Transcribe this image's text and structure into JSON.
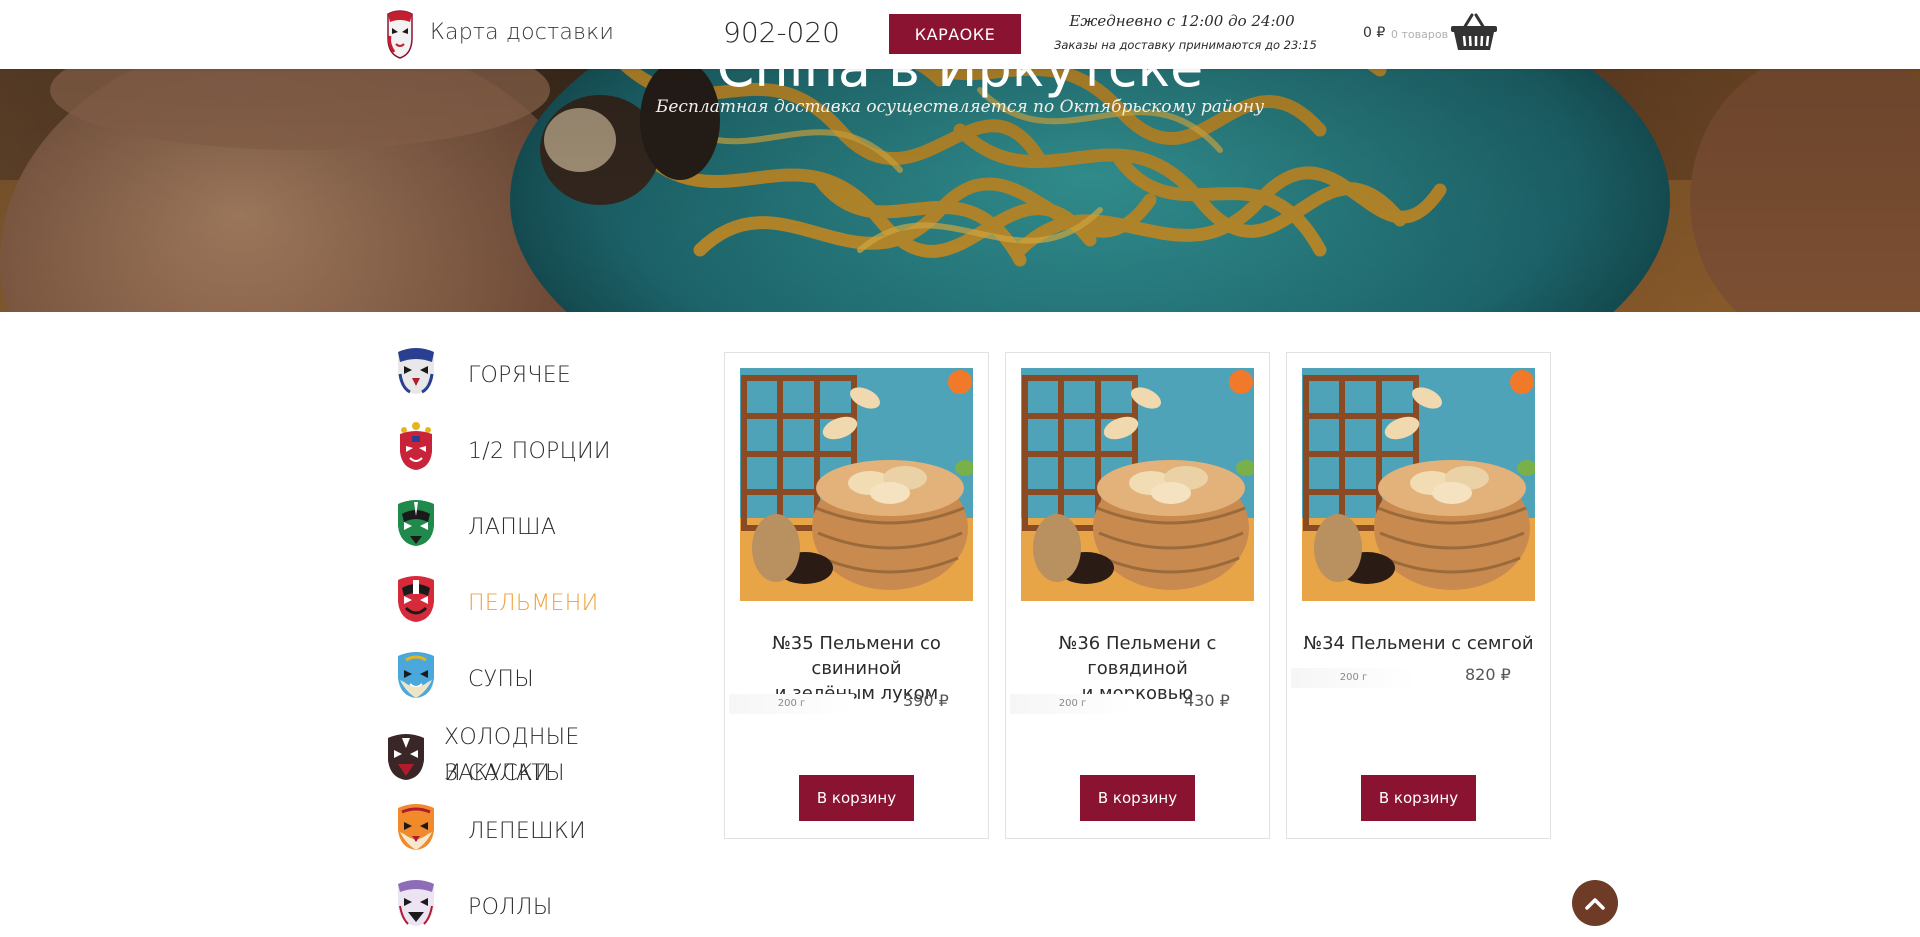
{
  "header": {
    "brand": "Карта доставки",
    "phone": "902-020",
    "karaoke_label": "КАРАОКЕ",
    "hours_line1": "Ежедневно с  12:00 до 24:00",
    "hours_line2": "Заказы на доставку принимаются до 23:15",
    "cart_total": "0 ₽",
    "cart_count": "0 товаров",
    "basket_icon": "basket-icon",
    "logo_icon": "opera-mask-logo"
  },
  "hero": {
    "title": "China в Иркутске",
    "subtitle": "Бесплатная доставка осуществляется по Октябрьскому району"
  },
  "categories": [
    {
      "label": "ГОРЯЧЕЕ",
      "icon": "opera-mask-icon",
      "active": false
    },
    {
      "label": "1/2 ПОРЦИИ",
      "icon": "opera-mask-icon",
      "active": false
    },
    {
      "label": "ЛАПША",
      "icon": "opera-mask-icon",
      "active": false
    },
    {
      "label": "ПЕЛЬМЕНИ",
      "icon": "opera-mask-icon",
      "active": true
    },
    {
      "label": "СУПЫ",
      "icon": "opera-mask-icon",
      "active": false
    },
    {
      "label": "ХОЛОДНЫЕ ЗАКУСКИ",
      "label2": "И САЛАТЫ",
      "icon": "opera-mask-icon",
      "active": false
    },
    {
      "label": "ЛЕПЕШКИ",
      "icon": "opera-mask-icon",
      "active": false
    },
    {
      "label": "РОЛЛЫ",
      "icon": "opera-mask-icon",
      "active": false
    }
  ],
  "products": [
    {
      "title_line1": "№35 Пельмени со свининой",
      "title_line2": "и зелёным луком",
      "weight": "200 г",
      "price": "390 ₽",
      "button": "В корзину"
    },
    {
      "title_line1": "№36 Пельмени с говядиной",
      "title_line2": "и морковью",
      "weight": "200 г",
      "price": "430 ₽",
      "button": "В корзину"
    },
    {
      "title_line1": "№34 Пельмени с семгой",
      "title_line2": "",
      "weight": "200 г",
      "price": "820 ₽",
      "button": "В корзину"
    }
  ],
  "colors": {
    "accent": "#8b1332",
    "active_category": "#f0a035",
    "scroll_button": "#6d3b26"
  },
  "scroll_top_icon": "chevron-up-icon"
}
